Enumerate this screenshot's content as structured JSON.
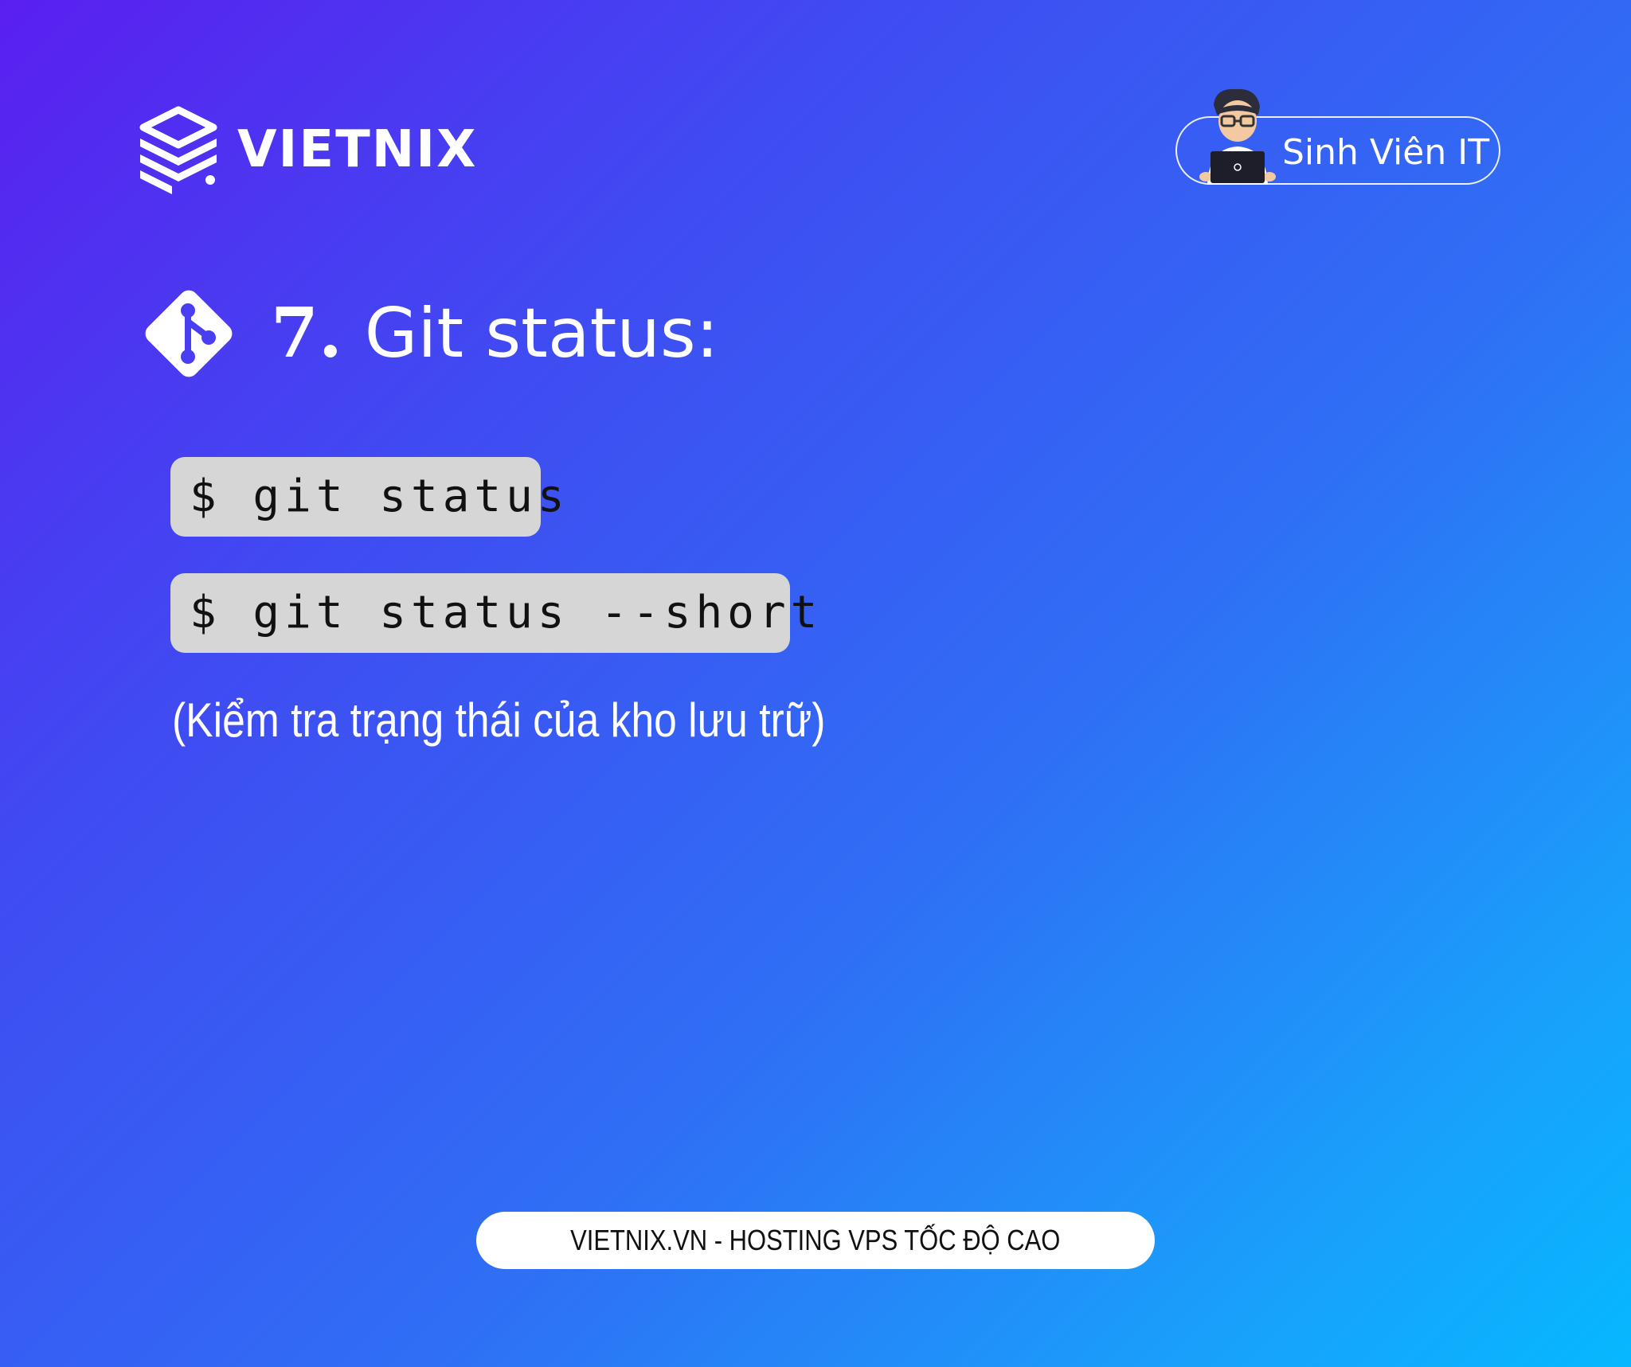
{
  "brand": {
    "name": "VIETNIX",
    "icon": "stacked-layers-logo"
  },
  "badge": {
    "label": "Sinh Viên IT",
    "icon": "student-with-laptop-avatar"
  },
  "heading": {
    "number": "7.",
    "title": "Git status:",
    "icon": "git-logo-icon"
  },
  "commands": [
    {
      "text": "$ git status"
    },
    {
      "text": "$ git status --short"
    }
  ],
  "description": "(Kiểm tra trạng thái của kho lưu trữ)",
  "footer": {
    "text": "VIETNIX.VN - HOSTING VPS TỐC ĐỘ CAO"
  },
  "colors": {
    "gradient_start": "#5a1ff0",
    "gradient_end": "#06b8ff",
    "code_bg": "#d6d6d6",
    "text": "#ffffff"
  }
}
